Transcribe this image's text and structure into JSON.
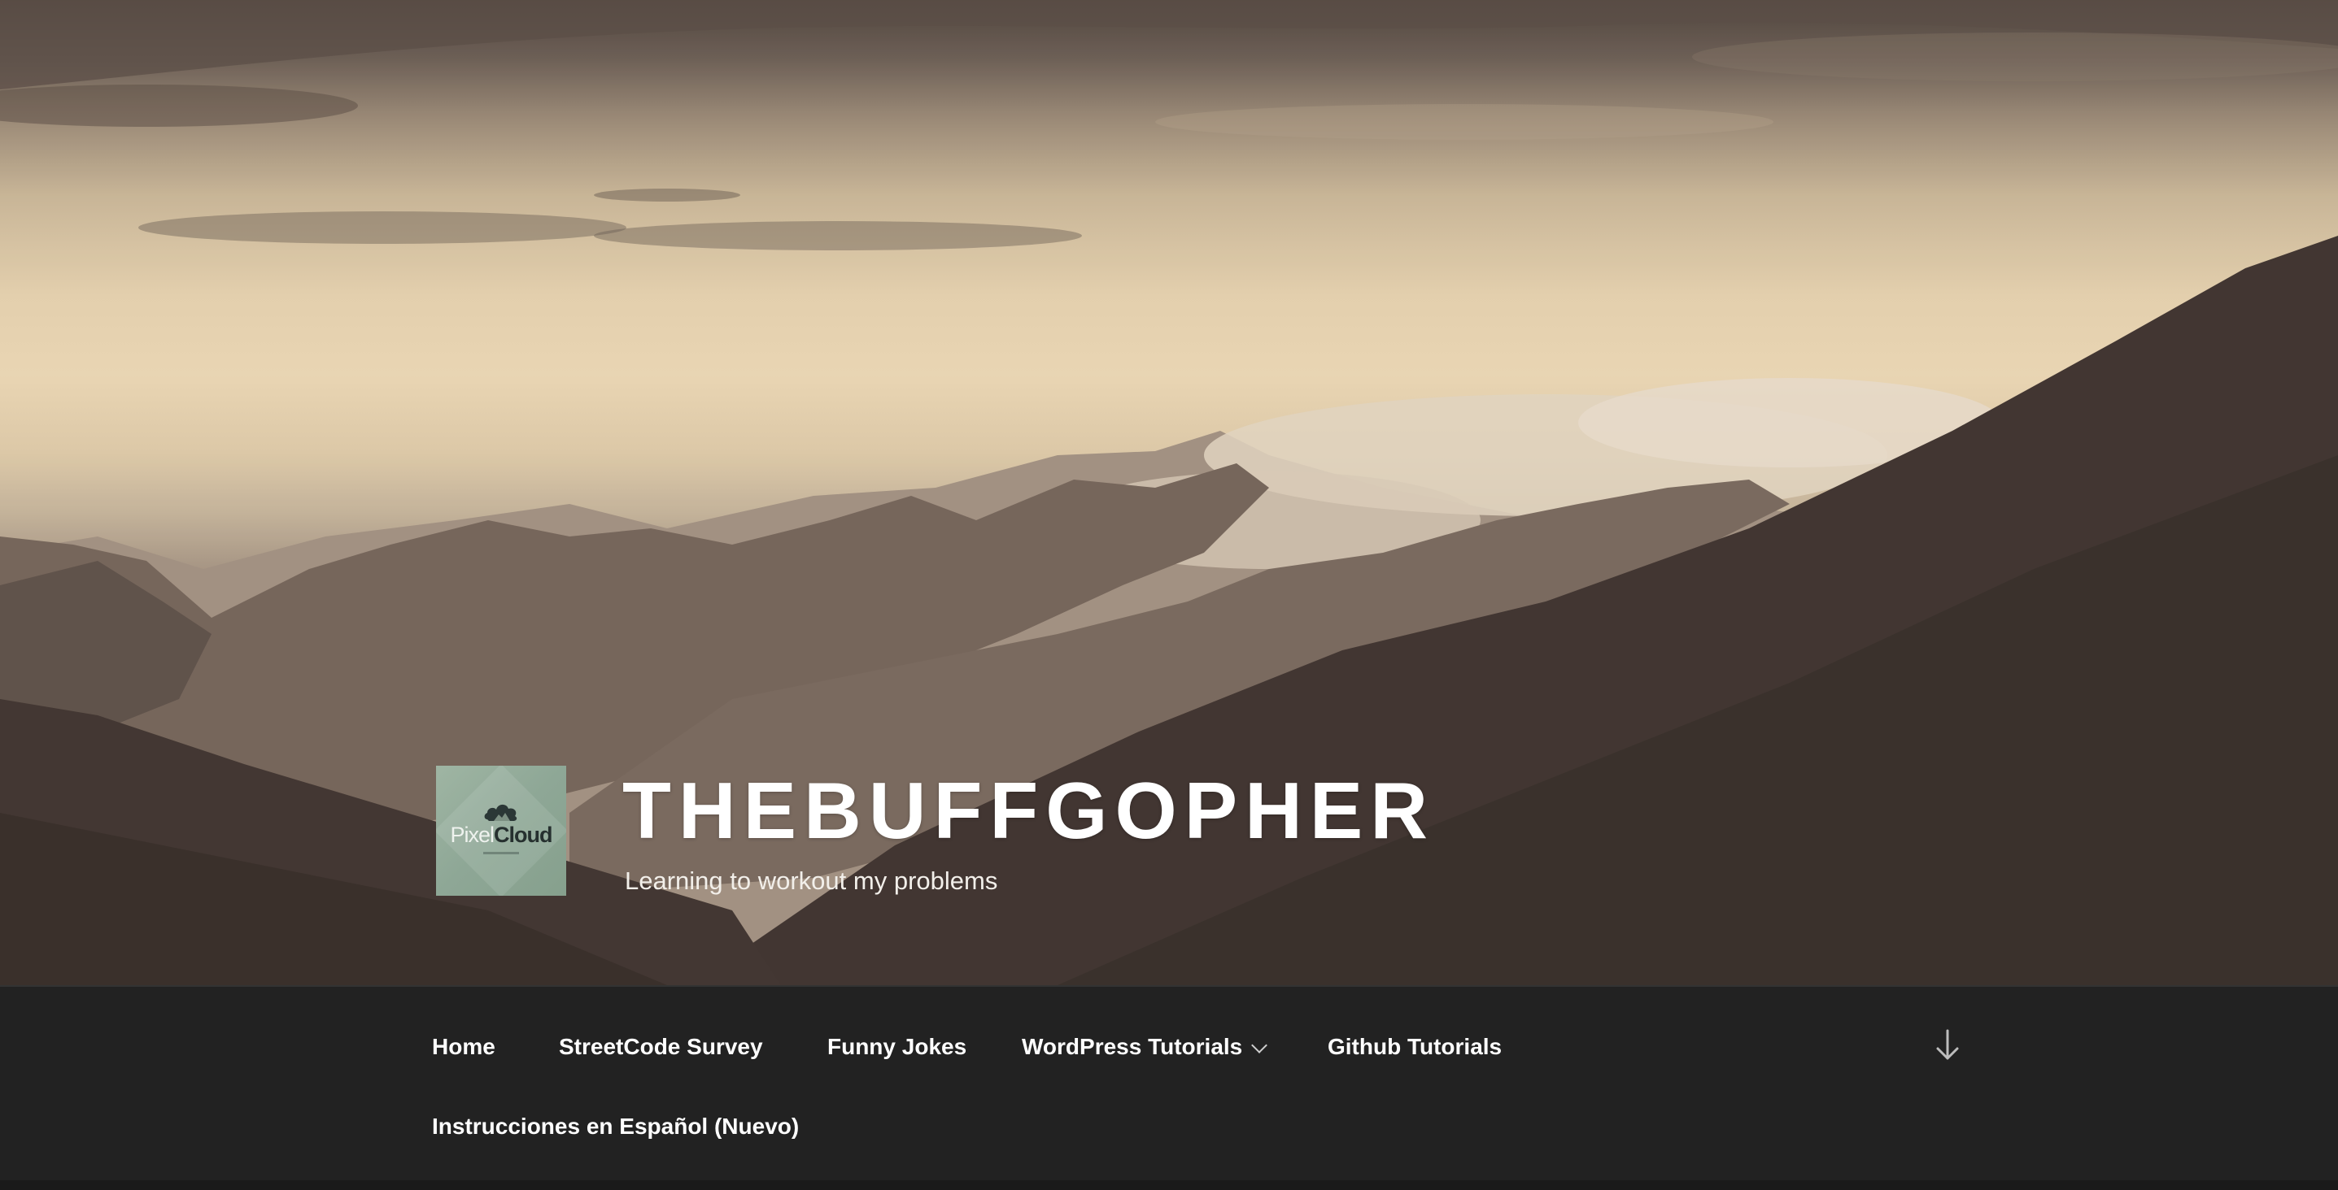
{
  "site": {
    "title": "THEBUFFGOPHER",
    "tagline": "Learning to workout my problems",
    "logo": {
      "wordmark_thin": "Pixel",
      "wordmark_bold": "Cloud"
    }
  },
  "nav": {
    "items": [
      {
        "label": "Home"
      },
      {
        "label": "StreetCode Survey"
      },
      {
        "label": "Funny Jokes"
      },
      {
        "label": "WordPress Tutorials",
        "has_submenu": true
      },
      {
        "label": "Github Tutorials"
      },
      {
        "label": "Instrucciones en Español (Nuevo)"
      }
    ],
    "scroll_icon": "arrow-down-icon"
  },
  "colors": {
    "nav_background": "#222222",
    "title_text": "#ffffff",
    "logo_background": "#8ea796"
  }
}
